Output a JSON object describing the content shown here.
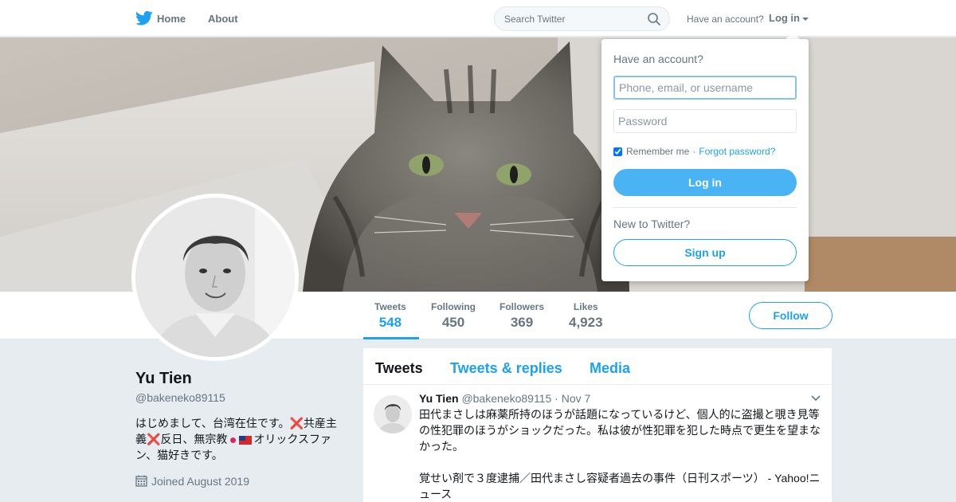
{
  "nav": {
    "home_label": "Home",
    "about_label": "About",
    "search_placeholder": "Search Twitter",
    "have_account": "Have an account?",
    "login_label": "Log in"
  },
  "stats": [
    {
      "label": "Tweets",
      "value": "548"
    },
    {
      "label": "Following",
      "value": "450"
    },
    {
      "label": "Followers",
      "value": "369"
    },
    {
      "label": "Likes",
      "value": "4,923"
    }
  ],
  "follow_label": "Follow",
  "profile": {
    "name": "Yu Tien",
    "handle": "@bakeneko89115",
    "bio_part1": "はじめまして、台湾在住です。",
    "bio_cross1": "❌",
    "bio_part2": "共産主義",
    "bio_cross2": "❌",
    "bio_part3": "反日、無宗教",
    "bio_part4": "オリックスファン、猫好きです。",
    "joined": "Joined August 2019"
  },
  "timeline": {
    "tabs": [
      "Tweets",
      "Tweets & replies",
      "Media"
    ],
    "tweet": {
      "name": "Yu Tien",
      "handle": "@bakeneko89115",
      "separator": "·",
      "time": "Nov 7",
      "text_line1": "田代まさしは麻薬所持のほうが話題になっているけど、個人的に盗撮と覗き見等の性犯罪のほうがショックだった。私は彼が性犯罪を犯した時点で更生を望まなかった。",
      "text_line2": "覚せい剤で３度逮捕／田代まさし容疑者過去の事件（日刊スポーツ） - Yahoo!ニュース"
    }
  },
  "login_dropdown": {
    "title": "Have an account?",
    "username_placeholder": "Phone, email, or username",
    "password_placeholder": "Password",
    "remember_label": "Remember me",
    "separator": "·",
    "forgot_label": "Forgot password?",
    "login_button": "Log in",
    "new_label": "New to Twitter?",
    "signup_button": "Sign up"
  },
  "colors": {
    "accent": "#1da1f2",
    "login_button": "#4ab3f4",
    "background": "#e6ecf0",
    "muted_text": "#657786"
  },
  "icons": {
    "logo": "twitter-bird-icon",
    "search": "search-icon",
    "calendar": "calendar-icon",
    "caret": "chevron-down-icon"
  }
}
